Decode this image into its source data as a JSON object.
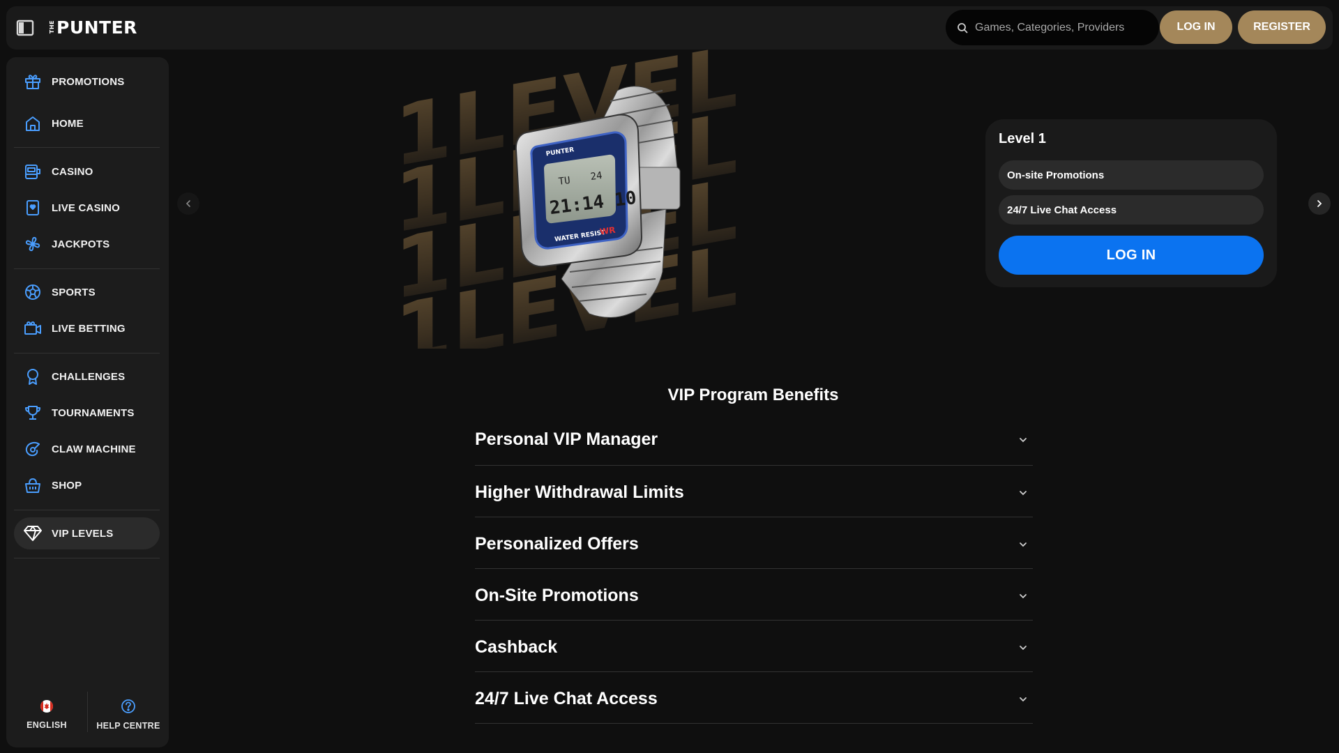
{
  "header": {
    "logo_prefix": "THE",
    "logo_text": "PUNTER",
    "search_placeholder": "Games, Categories, Providers",
    "login_label": "LOG IN",
    "register_label": "REGISTER"
  },
  "sidebar": {
    "items": [
      {
        "label": "PROMOTIONS",
        "icon": "gift-icon"
      },
      {
        "label": "HOME",
        "icon": "home-icon"
      },
      {
        "label": "CASINO",
        "icon": "slot-machine-icon"
      },
      {
        "label": "LIVE CASINO",
        "icon": "card-icon"
      },
      {
        "label": "JACKPOTS",
        "icon": "clover-icon"
      },
      {
        "label": "SPORTS",
        "icon": "soccer-ball-icon"
      },
      {
        "label": "LIVE BETTING",
        "icon": "video-camera-icon"
      },
      {
        "label": "CHALLENGES",
        "icon": "award-ribbon-icon"
      },
      {
        "label": "TOURNAMENTS",
        "icon": "trophy-icon"
      },
      {
        "label": "CLAW MACHINE",
        "icon": "claw-icon"
      },
      {
        "label": "SHOP",
        "icon": "shopping-basket-icon"
      },
      {
        "label": "VIP LEVELS",
        "icon": "diamond-icon"
      }
    ],
    "active_item": "VIP LEVELS",
    "footer": {
      "language_label": "ENGLISH",
      "help_label": "HELP CENTRE"
    }
  },
  "hero": {
    "background_word": "1LEVEL",
    "watch_display": {
      "day": "TU",
      "date": "24",
      "time": "21:14 10",
      "band": "WATER RESIST",
      "brand": "PUNTER"
    },
    "level_card": {
      "title": "Level 1",
      "benefits": [
        "On-site Promotions",
        "24/7 Live Chat Access"
      ],
      "login_label": "LOG IN"
    }
  },
  "benefits": {
    "title": "VIP Program Benefits",
    "items": [
      "Personal VIP Manager",
      "Higher Withdrawal Limits",
      "Personalized Offers",
      "On-Site Promotions",
      "Cashback",
      "24/7 Live Chat Access"
    ]
  },
  "colors": {
    "gold": "#a4875a",
    "blue": "#0b73f0",
    "background": "#0f0f0f",
    "panel": "#1c1c1c",
    "icon_blue": "#4a9eff"
  }
}
